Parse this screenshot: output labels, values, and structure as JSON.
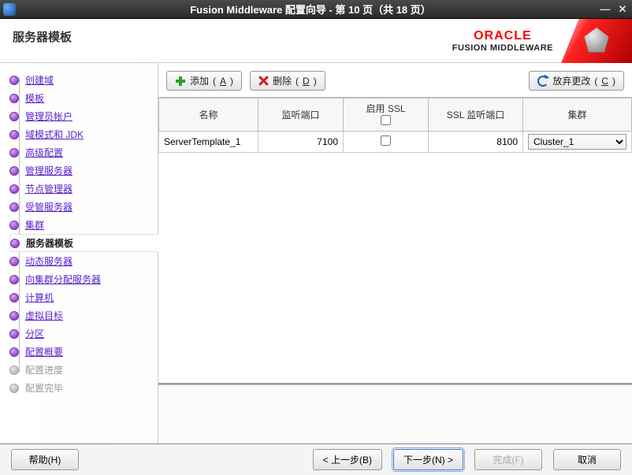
{
  "window": {
    "title": "Fusion Middleware 配置向导 - 第 10 页（共 18 页）"
  },
  "header": {
    "page_title": "服务器模板",
    "brand_top": "ORACLE",
    "brand_bottom": "FUSION MIDDLEWARE"
  },
  "sidebar": {
    "items": [
      {
        "label": "创建域",
        "state": "done"
      },
      {
        "label": "模板",
        "state": "done"
      },
      {
        "label": "管理员帐户",
        "state": "done"
      },
      {
        "label": "域模式和 JDK",
        "state": "done"
      },
      {
        "label": "高级配置",
        "state": "done"
      },
      {
        "label": "管理服务器",
        "state": "done"
      },
      {
        "label": "节点管理器",
        "state": "done"
      },
      {
        "label": "受管服务器",
        "state": "done"
      },
      {
        "label": "集群",
        "state": "done"
      },
      {
        "label": "服务器模板",
        "state": "current"
      },
      {
        "label": "动态服务器",
        "state": "todo"
      },
      {
        "label": "向集群分配服务器",
        "state": "todo"
      },
      {
        "label": "计算机",
        "state": "todo"
      },
      {
        "label": "虚拟目标",
        "state": "todo"
      },
      {
        "label": "分区",
        "state": "todo"
      },
      {
        "label": "配置概要",
        "state": "todo"
      },
      {
        "label": "配置进度",
        "state": "disabled"
      },
      {
        "label": "配置完毕",
        "state": "disabled"
      }
    ]
  },
  "toolbar": {
    "add_label": "添加",
    "add_mnemonic": "A",
    "delete_label": "删除",
    "delete_mnemonic": "D",
    "discard_label": "放弃更改",
    "discard_mnemonic": "C"
  },
  "table": {
    "columns": {
      "name": "名称",
      "listen_port": "监听端口",
      "enable_ssl": "启用 SSL",
      "ssl_listen_port": "SSL 监听端口",
      "cluster": "集群"
    },
    "rows": [
      {
        "name": "ServerTemplate_1",
        "listen_port": "7100",
        "enable_ssl": false,
        "ssl_listen_port": "8100",
        "cluster": "Cluster_1"
      }
    ]
  },
  "footer": {
    "help": "帮助",
    "help_mnemonic": "H",
    "back": "< 上一步",
    "back_mnemonic": "B",
    "next": "下一步",
    "next_mnemonic": "N",
    "next_suffix": " >",
    "finish": "完成",
    "finish_mnemonic": "F",
    "cancel": "取消"
  }
}
